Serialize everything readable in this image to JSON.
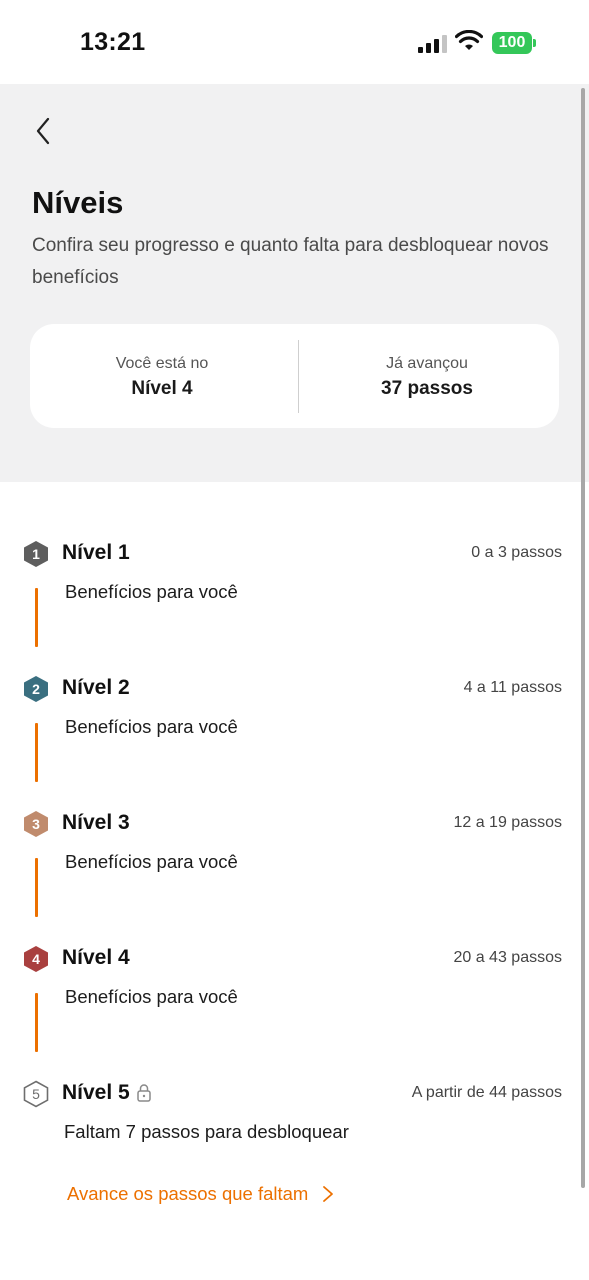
{
  "status": {
    "time": "13:21",
    "battery": "100"
  },
  "header": {
    "title": "Níveis",
    "subtitle": "Confira seu progresso e quanto falta para desbloquear novos benefícios"
  },
  "summary": {
    "current_label": "Você está no",
    "current_value": "Nível 4",
    "progress_label": "Já avançou",
    "progress_value": "37 passos"
  },
  "levels": [
    {
      "badge": "1",
      "name": "Nível 1",
      "range": "0 a 3 passos",
      "detail": "Benefícios para você",
      "badge_color": "#5e5e5e"
    },
    {
      "badge": "2",
      "name": "Nível 2",
      "range": "4 a 11 passos",
      "detail": "Benefícios para você",
      "badge_color": "#3a6f80"
    },
    {
      "badge": "3",
      "name": "Nível 3",
      "range": "12 a 19 passos",
      "detail": "Benefícios para você",
      "badge_color": "#c08b6d"
    },
    {
      "badge": "4",
      "name": "Nível 4",
      "range": "20 a 43 passos",
      "detail": "Benefícios para você",
      "badge_color": "#a9403f"
    },
    {
      "badge": "5",
      "name": "Nível 5",
      "range": "A partir de 44 passos",
      "detail": "Faltam 7 passos para desbloquear",
      "badge_color": "#6e6e6e",
      "locked": true
    }
  ],
  "cta": {
    "label": "Avance os passos que faltam"
  },
  "colors": {
    "accent": "#ec7000",
    "header_bg": "#f1f1f2"
  },
  "icons": {
    "back": "chevron-left-icon",
    "lock": "lock-icon",
    "cta_arrow": "chevron-right-icon"
  }
}
